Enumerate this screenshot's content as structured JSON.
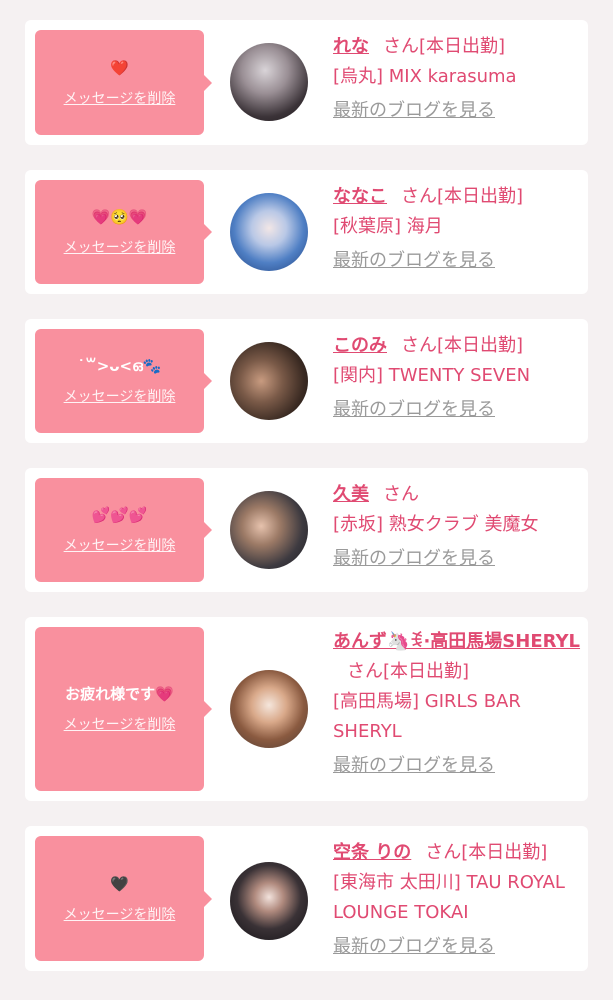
{
  "common": {
    "delete_label": "メッセージを削除",
    "blog_label": "最新のブログを見る",
    "suffix": "さん"
  },
  "cards": [
    {
      "name": "れな",
      "status": "[本日出勤]",
      "shop": "[烏丸] MIX karasuma",
      "message": "❤️"
    },
    {
      "name": "ななこ",
      "status": "[本日出勤]",
      "shop": "[秋葉原] 海月",
      "message": "💗🥺💗"
    },
    {
      "name": "このみ",
      "status": "[本日出勤]",
      "shop": "[関内] TWENTY SEVEN",
      "message": "˙꒳>ᴗ<ഒ🐾"
    },
    {
      "name": "久美",
      "status": "",
      "shop": "[赤坂] 熟女クラブ 美魔女",
      "message": "💕💕💕"
    },
    {
      "name": "あんず🦄ꉂ·高田馬場SHERYL",
      "status": "[本日出勤]",
      "shop": "[高田馬場] GIRLS BAR SHERYL",
      "message": "お疲れ様です💗"
    },
    {
      "name": "空条 りの",
      "status": "[本日出勤]",
      "shop": "[東海市 太田川] TAU ROYAL LOUNGE TOKAI",
      "message": "🖤"
    }
  ]
}
